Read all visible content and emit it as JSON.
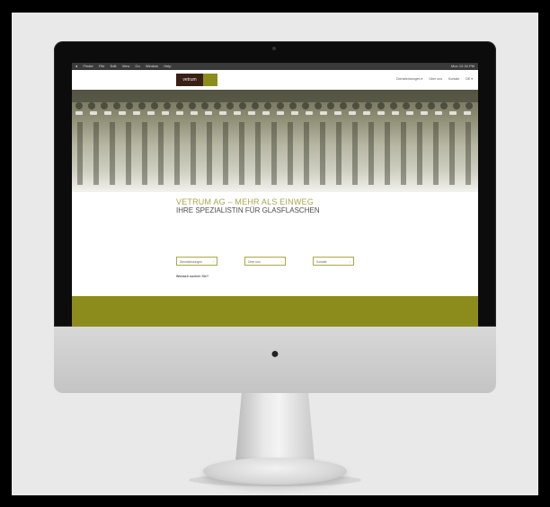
{
  "menubar": {
    "apple": "",
    "items": [
      "Finder",
      "File",
      "Edit",
      "View",
      "Go",
      "Window",
      "Help"
    ],
    "status": "Mon 12:34 PM"
  },
  "site": {
    "logo_text": "vetrum",
    "nav": [
      "Dienstleistungen ▾",
      "Über uns",
      "Kontakt",
      "DE ▾"
    ]
  },
  "content": {
    "headline": "VETRUM AG – MEHR ALS EINWEG",
    "subheadline": "IHRE SPEZIALISTIN FÜR GLASFLASCHEN",
    "ask": "Wonach suchen Sie?"
  },
  "search_buttons": [
    "Dienstleistungen",
    "Über uns",
    "Kontakt"
  ],
  "colors": {
    "accent": "#a8a84a",
    "footer": "#8c8c1c",
    "logo_dark": "#3a1f14",
    "backdrop": "#e9e9e9"
  }
}
